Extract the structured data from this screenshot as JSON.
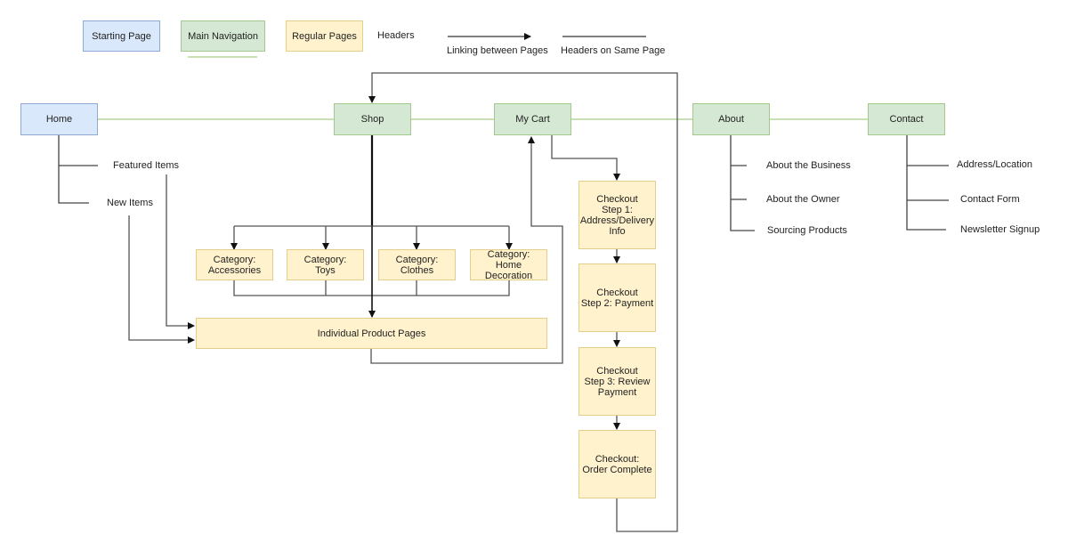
{
  "legend": {
    "starting_page": "Starting Page",
    "main_navigation": "Main Navigation",
    "regular_pages": "Regular Pages",
    "headers": "Headers",
    "linking_between_pages": "Linking between Pages",
    "headers_on_same_page": "Headers on Same Page"
  },
  "colors": {
    "starting_fill": "#dae8fc",
    "nav_fill": "#d5e8d4",
    "regular_fill": "#fff2cc",
    "nav_line": "#b5d69c",
    "link_line": "#555555"
  },
  "nav": {
    "home": "Home",
    "shop": "Shop",
    "cart": "My Cart",
    "about": "About",
    "contact": "Contact"
  },
  "home_headers": [
    "Featured Items",
    "New Items"
  ],
  "categories": [
    "Category:\nAccessories",
    "Category:\nToys",
    "Category:\nClothes",
    "Category:\nHome Decoration"
  ],
  "product_pages": "Individual Product Pages",
  "checkout_steps": [
    "Checkout\nStep 1:\nAddress/Delivery\nInfo",
    "Checkout\nStep 2: Payment",
    "Checkout\nStep 3: Review\nPayment",
    "Checkout:\nOrder Complete"
  ],
  "about_headers": [
    "About the Business",
    "About the Owner",
    "Sourcing Products"
  ],
  "contact_headers": [
    "Address/Location",
    "Contact Form",
    "Newsletter Signup"
  ]
}
